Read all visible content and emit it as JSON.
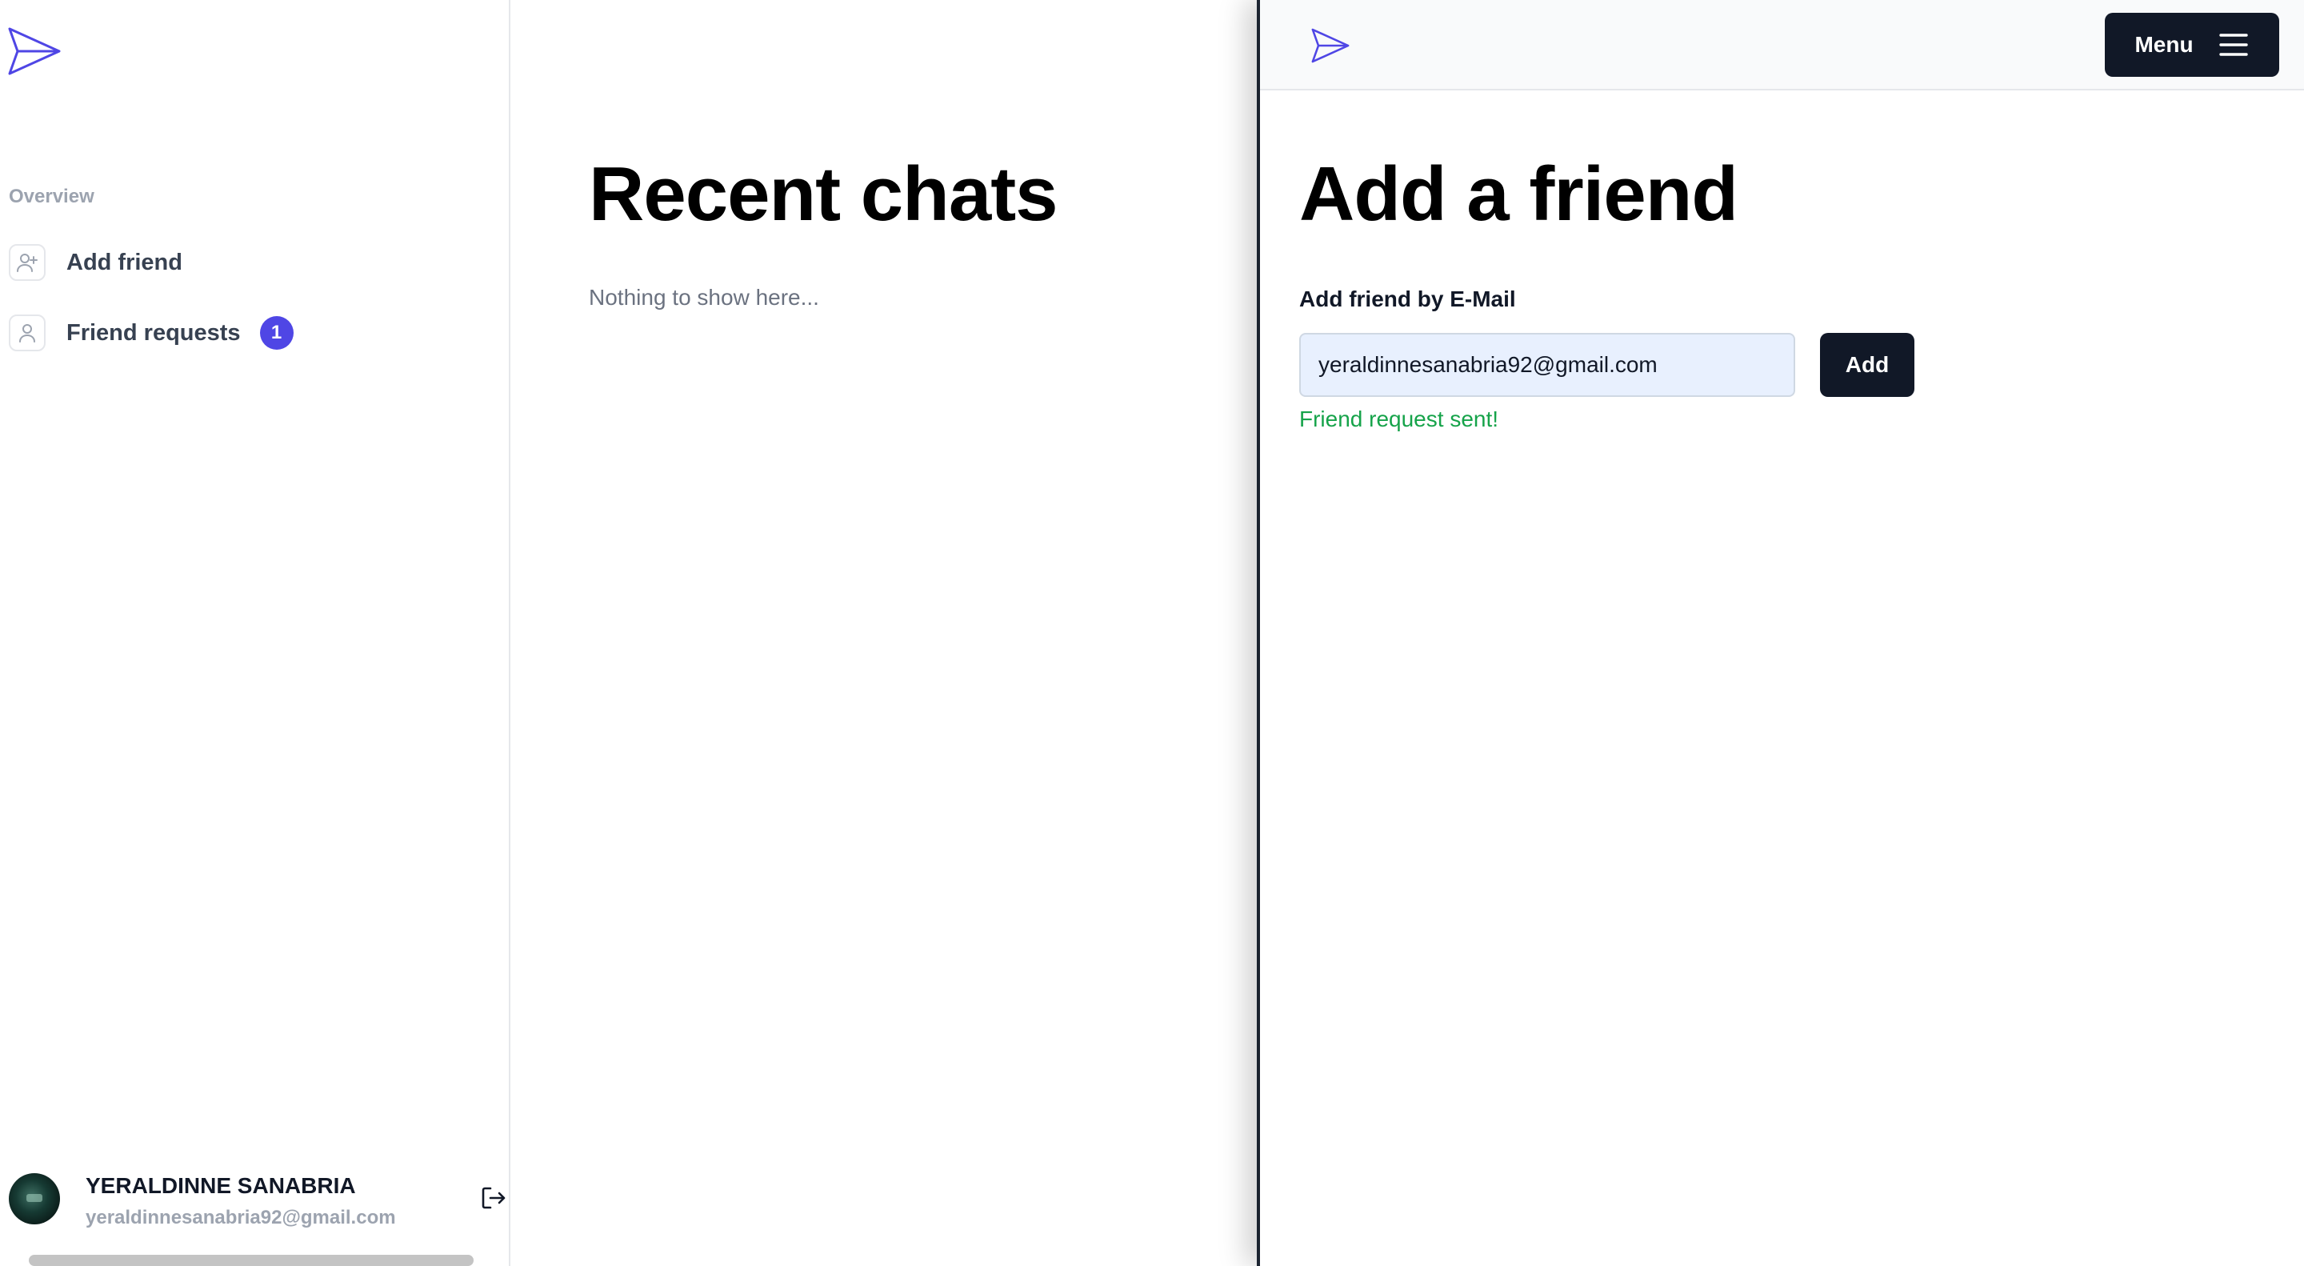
{
  "sidebar": {
    "section_label": "Overview",
    "items": [
      {
        "label": "Add friend",
        "icon": "user-plus-icon"
      },
      {
        "label": "Friend requests",
        "icon": "user-icon",
        "badge": "1"
      }
    ],
    "user": {
      "name": "YERALDINNE SANABRIA",
      "email": "yeraldinnesanabria92@gmail.com"
    }
  },
  "dashboard": {
    "title": "Recent chats",
    "empty_message": "Nothing to show here..."
  },
  "mobile": {
    "menu_label": "Menu",
    "title": "Add a friend",
    "form": {
      "label": "Add friend by E-Mail",
      "email_value": "yeraldinnesanabria92@gmail.com",
      "submit_label": "Add",
      "status_message": "Friend request sent!"
    }
  },
  "colors": {
    "accent": "#4f46e5",
    "button_dark": "#111827",
    "success": "#16a34a",
    "muted": "#9ca3af"
  }
}
